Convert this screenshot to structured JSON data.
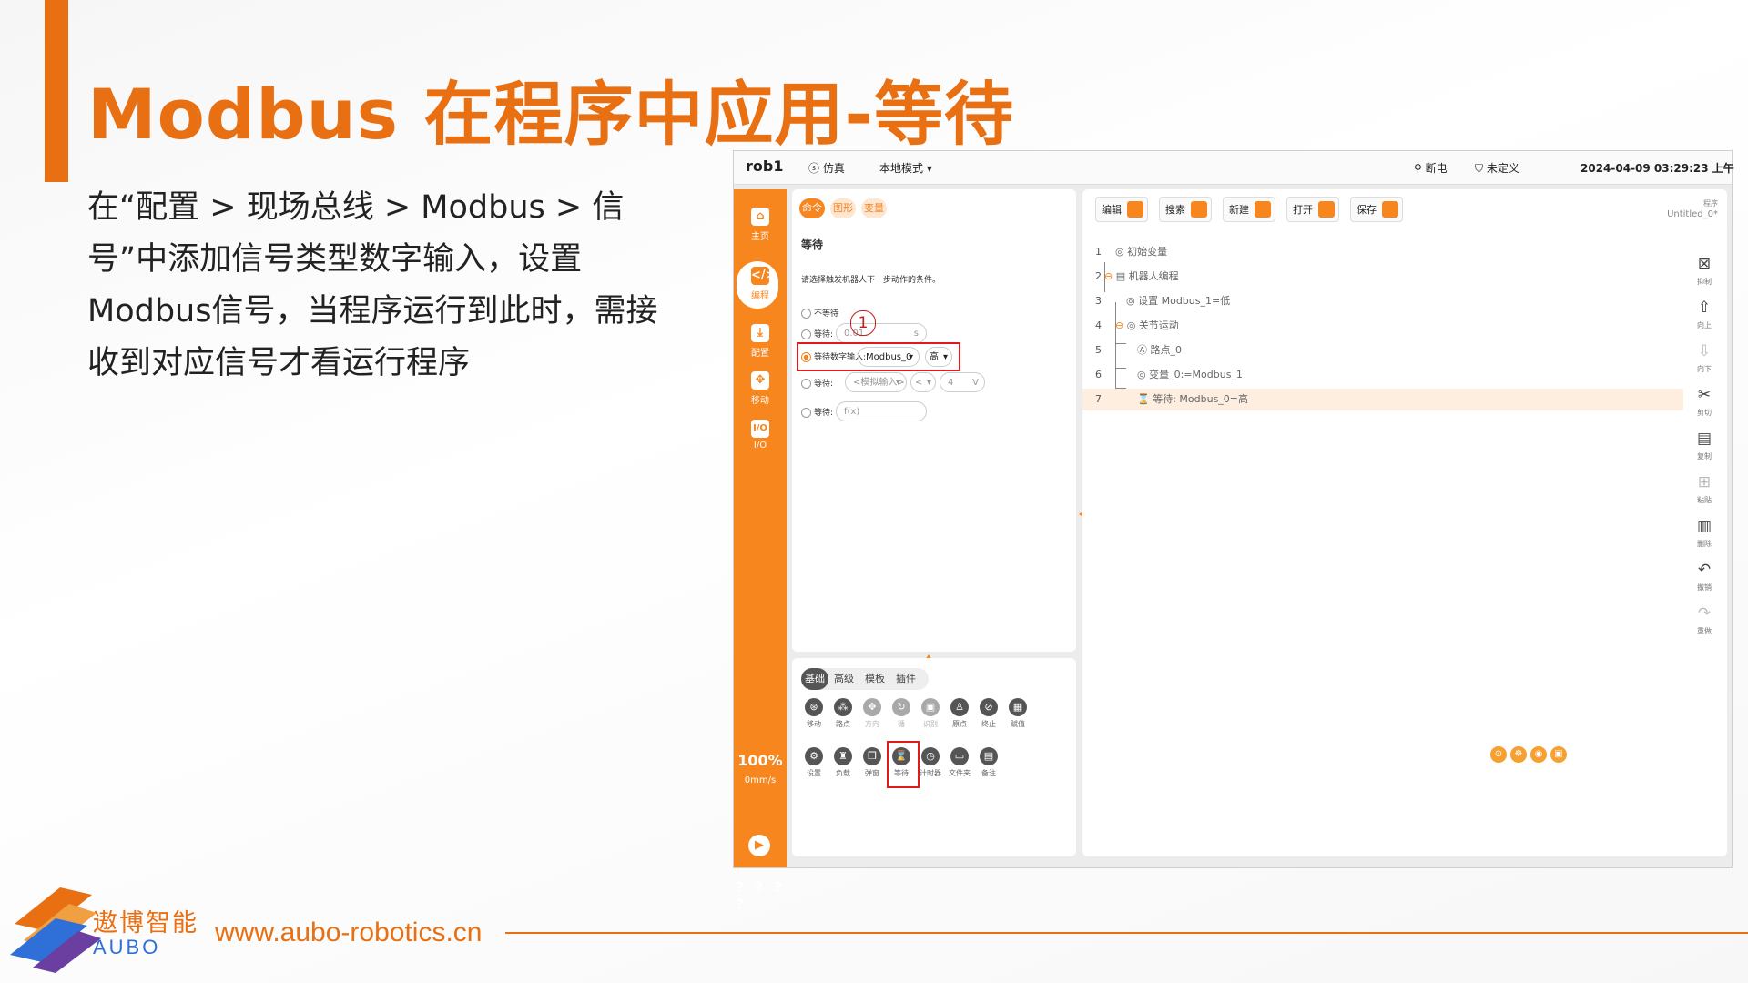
{
  "slide": {
    "title": "Modbus 在程序中应用-等待",
    "body": "在“配置 > 现场总线 > Modbus > 信号”中添加信号类型数字输入，设置 Modbus信号，当程序运行到此时，需接收到对应信号才看运行程序",
    "logo_cn": "遨博智能",
    "logo_en": "AUBO",
    "url": "www.aubo-robotics.cn",
    "colors": {
      "accent": "#e86f12",
      "ui_orange": "#f7861f",
      "highlight_red": "#e01b1b"
    }
  },
  "topbar": {
    "robot": "rob1",
    "sim": "仿真",
    "mode": "本地模式",
    "power": "断电",
    "safety": "未定义",
    "datetime": "2024-04-09 03:29:23 上午"
  },
  "sidebar": {
    "items": [
      {
        "label": "主页",
        "icon": "home-icon"
      },
      {
        "label": "编程",
        "icon": "code-icon"
      },
      {
        "label": "配置",
        "icon": "config-icon"
      },
      {
        "label": "移动",
        "icon": "move-icon"
      },
      {
        "label": "I/O",
        "icon": "io-icon"
      }
    ],
    "speed_pct": "100%",
    "speed": "0mm/s",
    "help": "? ? ? ?"
  },
  "cmd_panel": {
    "tabs": [
      "命令",
      "图形",
      "变量"
    ],
    "heading": "等待",
    "desc": "请选择触发机器人下一步动作的条件。",
    "options": {
      "no_wait": "不等待",
      "wait_time_label": "等待:",
      "wait_time_value": "0.01",
      "wait_time_unit": "s",
      "wait_digital_label": "等待数字输入:",
      "digital_signal": "Modbus_0",
      "digital_level": "高",
      "wait_analog_label": "等待:",
      "analog_signal": "<模拟输入>",
      "analog_op": "<",
      "analog_value": "4",
      "analog_unit": "V",
      "wait_expr_label": "等待:",
      "expr_placeholder": "f(x)"
    },
    "marker": "1"
  },
  "palette": {
    "tabs": [
      "基础",
      "高级",
      "模板",
      "插件"
    ],
    "row1": [
      "移动",
      "路点",
      "方向",
      "循",
      "识别",
      "原点",
      "终止",
      "赋值"
    ],
    "row2": [
      "设置",
      "负载",
      "弹窗",
      "等待",
      "计时器",
      "文件夹",
      "备注"
    ]
  },
  "program_panel": {
    "toolbar": [
      "编辑",
      "搜索",
      "新建",
      "打开",
      "保存"
    ],
    "program_label": "程序",
    "program_name": "Untitled_0*",
    "tree": [
      {
        "n": "1",
        "text": "初始变量"
      },
      {
        "n": "2",
        "text": "机器人编程"
      },
      {
        "n": "3",
        "text": "设置 Modbus_1=低"
      },
      {
        "n": "4",
        "text": "关节运动"
      },
      {
        "n": "5",
        "text": "路点_0"
      },
      {
        "n": "6",
        "text": "变量_0:=Modbus_1"
      },
      {
        "n": "7",
        "text": "等待: Modbus_0=高"
      }
    ],
    "side_tools": [
      "抑制",
      "向上",
      "向下",
      "剪切",
      "复制",
      "粘贴",
      "删除",
      "撤销",
      "重做"
    ]
  }
}
